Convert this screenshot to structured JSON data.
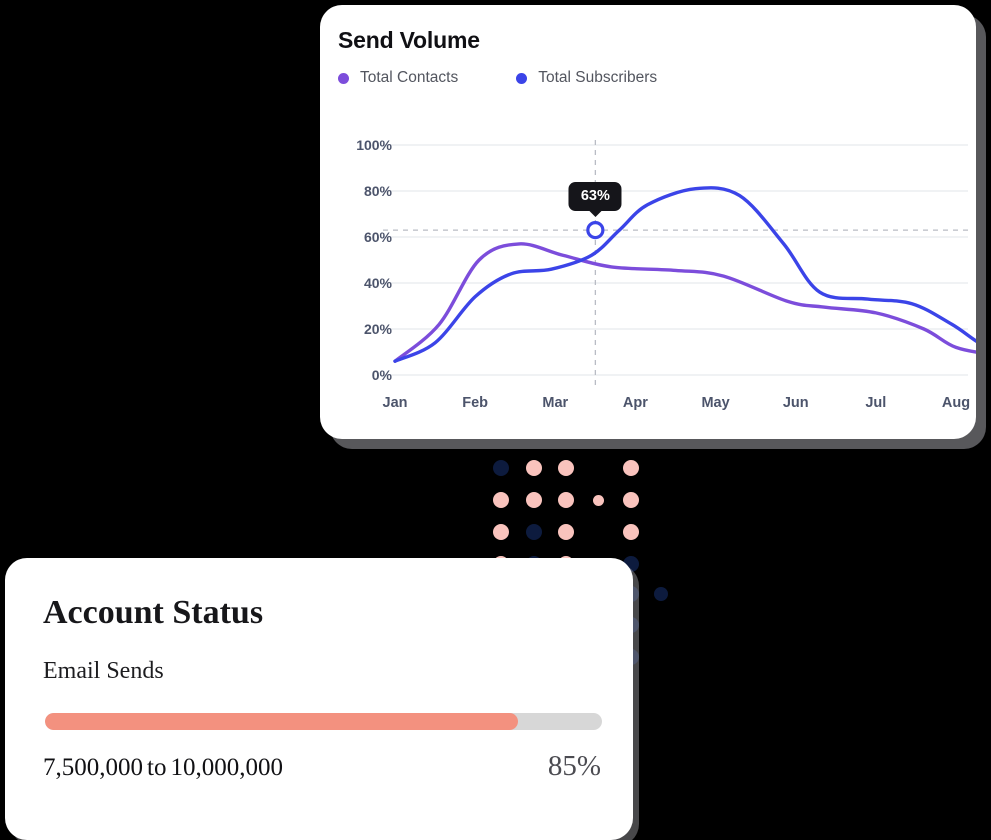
{
  "chart_card": {
    "title": "Send Volume",
    "legend": [
      {
        "label": "Total Contacts",
        "color": "#7c4ddb",
        "icon": "legend-dot-icon"
      },
      {
        "label": "Total Subscribers",
        "color": "#3b44e8",
        "icon": "legend-dot-icon"
      }
    ],
    "tooltip": {
      "value": "63%"
    }
  },
  "chart_data": {
    "type": "line",
    "title": "Send Volume",
    "xlabel": "",
    "ylabel": "",
    "ylim": [
      0,
      100
    ],
    "ytick_labels": [
      "100%",
      "80%",
      "60%",
      "40%",
      "20%",
      "0%"
    ],
    "yticks": [
      100,
      80,
      60,
      40,
      20,
      0
    ],
    "categories": [
      "Jan",
      "Feb",
      "Mar",
      "Apr",
      "May",
      "Jun",
      "Jul",
      "Aug"
    ],
    "grid": true,
    "legend_position": "top-left",
    "series": [
      {
        "name": "Total Contacts",
        "color": "#7c4ddb",
        "values": [
          6,
          46,
          57,
          47,
          45,
          30,
          22,
          9
        ]
      },
      {
        "name": "Total Subscribers",
        "color": "#3b44e8",
        "values": [
          6,
          33,
          45,
          70,
          81,
          34,
          31,
          9
        ]
      }
    ],
    "annotations": [
      {
        "label": "63%",
        "x": "Mar-Apr",
        "y": 63,
        "marker": "ring",
        "crosshair": true
      }
    ]
  },
  "status_card": {
    "title": "Account Status",
    "subtitle": "Email Sends",
    "progress": {
      "percent": 85,
      "fill_color": "#f3917f",
      "track_color": "#d7d7d7"
    },
    "range_from": "7,500,000",
    "range_connector": "to",
    "range_to": "10,000,000",
    "percent_label": "85%"
  },
  "decoration": {
    "dot_colors": {
      "pink": "#f9c3bd",
      "navy": "#0d1b3e"
    }
  }
}
